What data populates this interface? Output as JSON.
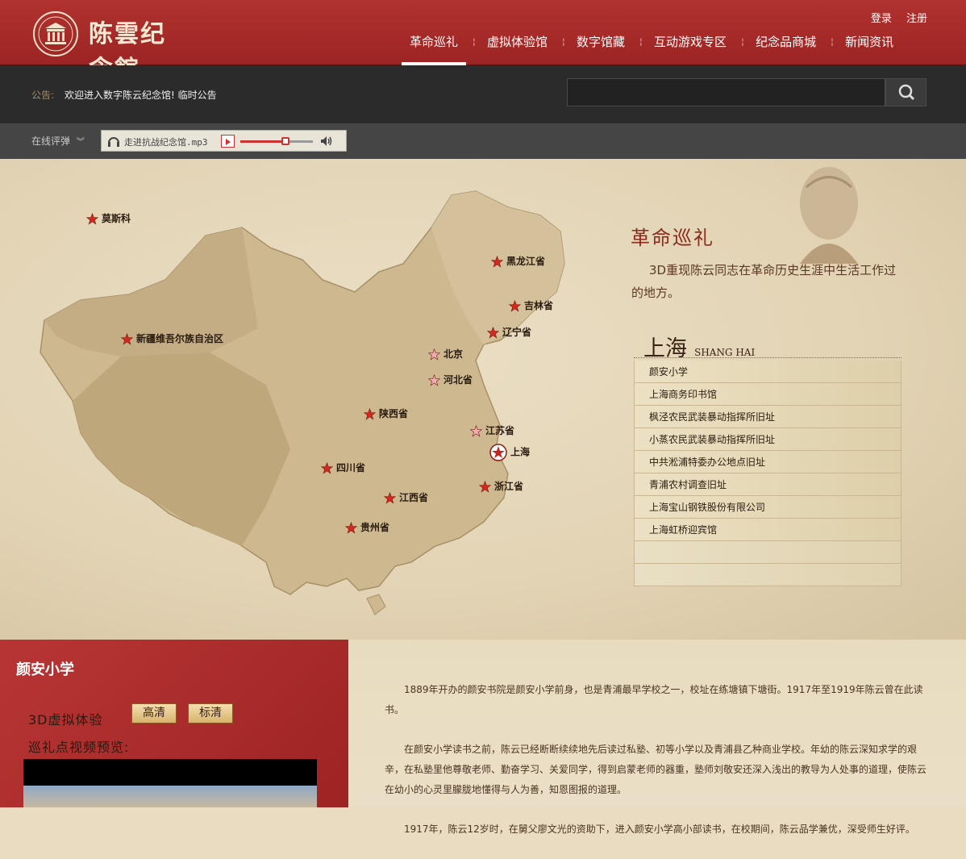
{
  "header": {
    "logo_text": "陈雲纪念館",
    "login": "登录",
    "register": "注册",
    "nav": [
      "革命巡礼",
      "虚拟体验馆",
      "数字馆藏",
      "互动游戏专区",
      "纪念品商城",
      "新闻资讯"
    ],
    "nav_active_index": 0
  },
  "notice": {
    "label": "公告:",
    "text": "欢迎进入数字陈云纪念馆!  临时公告",
    "search_placeholder": ""
  },
  "player": {
    "review_label": "在线评弹",
    "track": "走进抗战纪念馆.mp3",
    "progress": 0.62
  },
  "map": {
    "title": "革命巡礼",
    "description": "3D重现陈云同志在革命历史生涯中生活工作过的地方。",
    "cities": [
      {
        "name": "莫斯科",
        "style": "red"
      },
      {
        "name": "黑龙江省",
        "style": "red"
      },
      {
        "name": "吉林省",
        "style": "red"
      },
      {
        "name": "辽宁省",
        "style": "red"
      },
      {
        "name": "新疆维吾尔族自治区",
        "style": "red"
      },
      {
        "name": "北京",
        "style": "pink"
      },
      {
        "name": "河北省",
        "style": "pink"
      },
      {
        "name": "陕西省",
        "style": "red"
      },
      {
        "name": "江苏省",
        "style": "pink"
      },
      {
        "name": "上海",
        "style": "selected"
      },
      {
        "name": "四川省",
        "style": "red"
      },
      {
        "name": "浙江省",
        "style": "red"
      },
      {
        "name": "江西省",
        "style": "red"
      },
      {
        "name": "贵州省",
        "style": "red"
      }
    ],
    "province_name": "上海",
    "province_en": "SHANG HAI",
    "sites": [
      "颜安小学",
      "上海商务印书馆",
      "枫泾农民武装暴动指挥所旧址",
      "小蒸农民武装暴动指挥所旧址",
      "中共淞浦特委办公地点旧址",
      "青浦农村调查旧址",
      "上海宝山钢铁股份有限公司",
      "上海虹桥迎宾馆"
    ]
  },
  "detail": {
    "title": "颜安小学",
    "vr_label": "3D虚拟体验",
    "hd_button": "高清",
    "sd_button": "标清",
    "preview_label": "巡礼点视频预览:",
    "paragraphs": [
      "1889年开办的颜安书院是颜安小学前身，也是青浦最早学校之一，校址在练塘镇下塘街。1917年至1919年陈云曾在此读书。",
      "在颜安小学读书之前，陈云已经断断续续地先后读过私塾、初等小学以及青浦县乙种商业学校。年幼的陈云深知求学的艰辛，在私塾里他尊敬老师、勤奋学习、关爱同学，得到启蒙老师的器重，塾师刘敬安还深入浅出的教导为人处事的道理，使陈云在幼小的心灵里朦胧地懂得与人为善，知恩图报的道理。",
      "1917年，陈云12岁时，在舅父廖文光的资助下，进入颜安小学高小部读书，在校期间，陈云品学兼优，深受师生好评。"
    ]
  },
  "colors": {
    "header_red": "#a52a28",
    "notice_bg": "#2b2b2b",
    "player_bar": "#454545",
    "map_bg": "#e2d3b4"
  }
}
